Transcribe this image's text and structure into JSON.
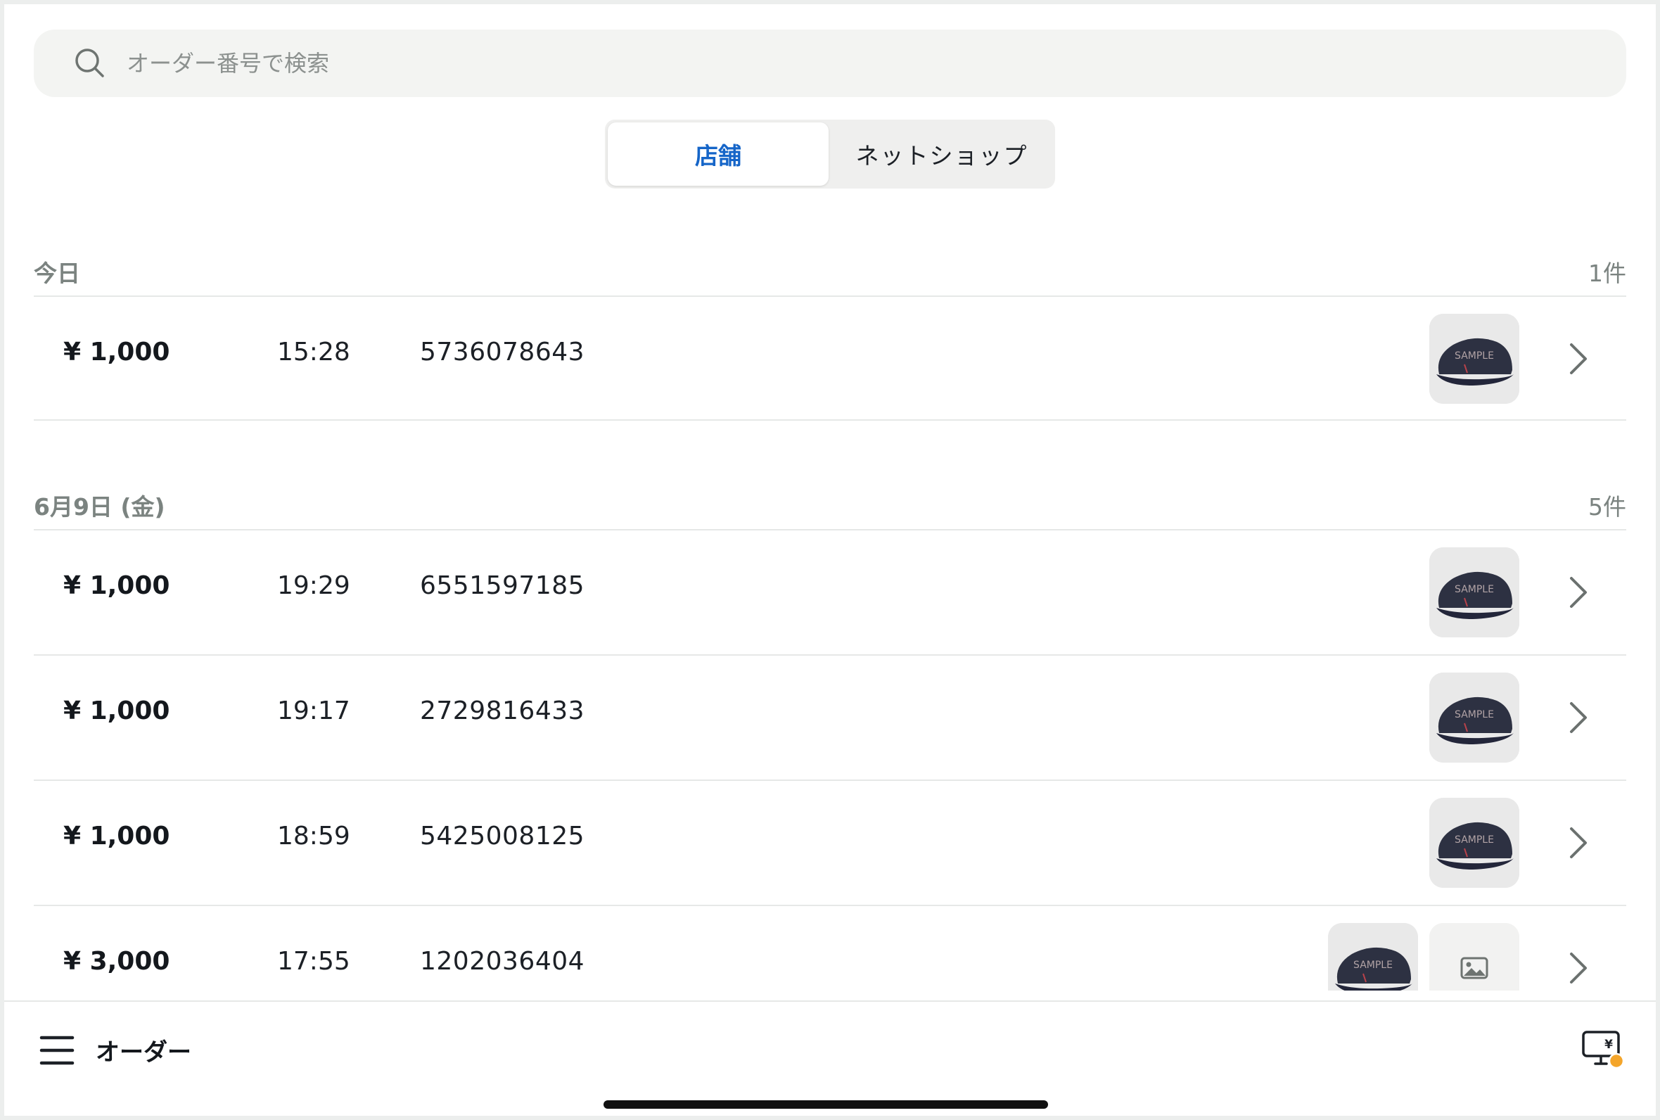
{
  "search": {
    "placeholder": "オーダー番号で検索"
  },
  "tabs": [
    {
      "label": "店舗",
      "active": true
    },
    {
      "label": "ネットショップ",
      "active": false
    }
  ],
  "sections": [
    {
      "title": "今日",
      "count": "1件",
      "orders": [
        {
          "amount": "¥ 1,000",
          "time": "15:28",
          "order_no": "5736078643",
          "thumbnails": [
            "cap-sample-image"
          ]
        }
      ]
    },
    {
      "title": "6月9日 (金)",
      "count": "5件",
      "orders": [
        {
          "amount": "¥ 1,000",
          "time": "19:29",
          "order_no": "6551597185",
          "thumbnails": [
            "cap-sample-image"
          ]
        },
        {
          "amount": "¥ 1,000",
          "time": "19:17",
          "order_no": "2729816433",
          "thumbnails": [
            "cap-sample-image"
          ]
        },
        {
          "amount": "¥ 1,000",
          "time": "18:59",
          "order_no": "5425008125",
          "thumbnails": [
            "cap-sample-image"
          ]
        },
        {
          "amount": "¥ 3,000",
          "time": "17:55",
          "order_no": "1202036404",
          "thumbnails": [
            "cap-sample-image",
            "image-placeholder-icon"
          ]
        }
      ]
    }
  ],
  "bottom_bar": {
    "title": "オーダー",
    "menu_icon": "hamburger-menu-icon",
    "register_icon": "register-display-icon"
  },
  "colors": {
    "accent": "#1565c8",
    "muted": "#7b8380",
    "badge": "#f4a52a"
  }
}
